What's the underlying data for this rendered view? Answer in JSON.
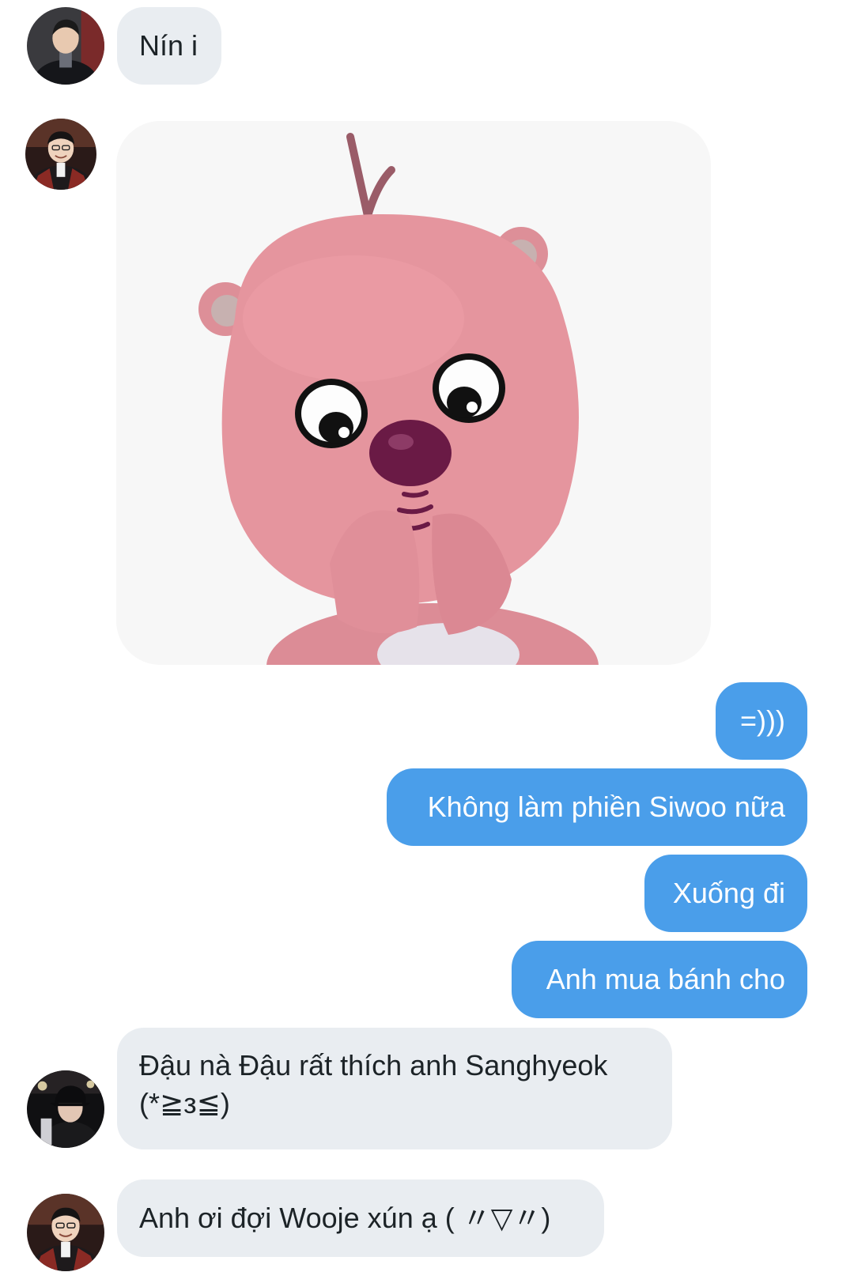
{
  "messages": {
    "m1": {
      "text": "Nín i",
      "avatar": "avatar-person-dark-jacket"
    },
    "m2": {
      "sticker": "pink-beaver-pleading-sticker",
      "avatar": "avatar-person-smiling-suit"
    },
    "m3": {
      "text": "=)))"
    },
    "m4": {
      "text": "Không làm phiền Siwoo nữa"
    },
    "m5": {
      "text": "Xuống đi"
    },
    "m6": {
      "text": "Anh mua bánh cho"
    },
    "m7": {
      "line1": "Đậu nà Đậu rất thích anh Sanghyeok",
      "line2": "(*≧з≦)",
      "avatar": "avatar-person-dark-cap"
    },
    "m8": {
      "text": "Anh ơi đợi Wooje xún ạ ( 〃▽〃)",
      "avatar": "avatar-person-smiling-suit"
    }
  },
  "colors": {
    "incoming_bubble": "#e9edf1",
    "outgoing_bubble": "#4a9eea",
    "incoming_text": "#1c2327",
    "outgoing_text": "#ffffff"
  }
}
